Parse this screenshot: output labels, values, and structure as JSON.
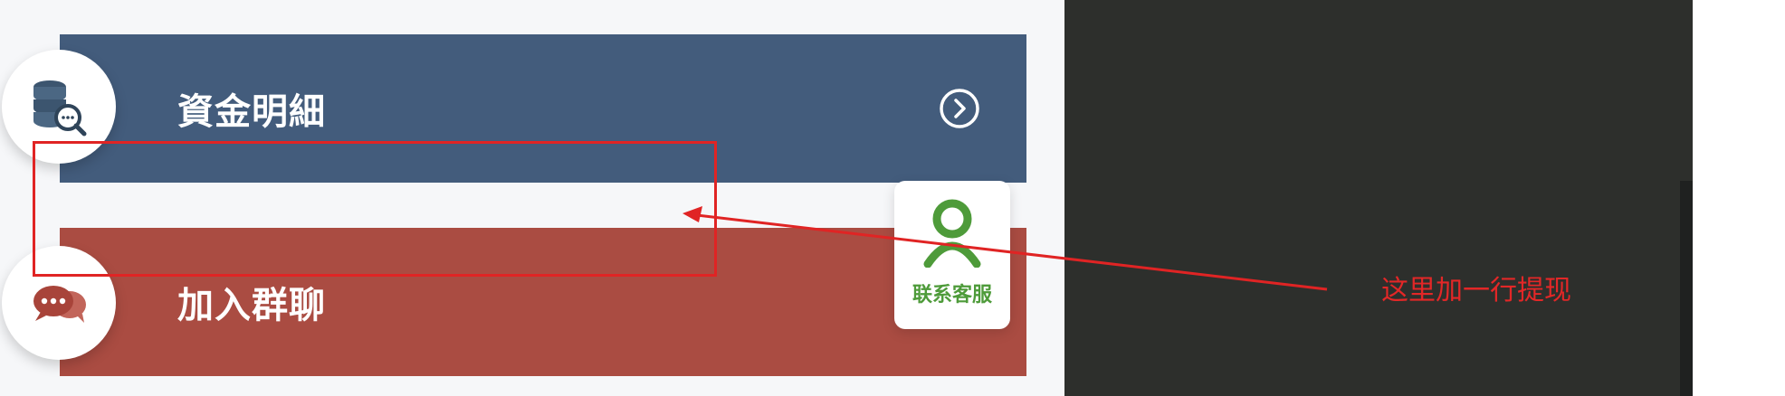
{
  "menu": {
    "funds_label": "資金明細",
    "group_label": "加入群聊"
  },
  "service": {
    "label": "联系客服"
  },
  "annotation": {
    "note": "这里加一行提现"
  },
  "colors": {
    "funds_row": "#435c7c",
    "group_row": "#aa4c42",
    "service_green": "#4e9b3a",
    "annotation_red": "#e02424",
    "dark_panel": "#2d2f2c"
  },
  "icons": {
    "funds": "database-search-icon",
    "group": "chat-bubbles-icon",
    "arrow": "chevron-right-circle-icon",
    "service": "customer-service-icon"
  }
}
